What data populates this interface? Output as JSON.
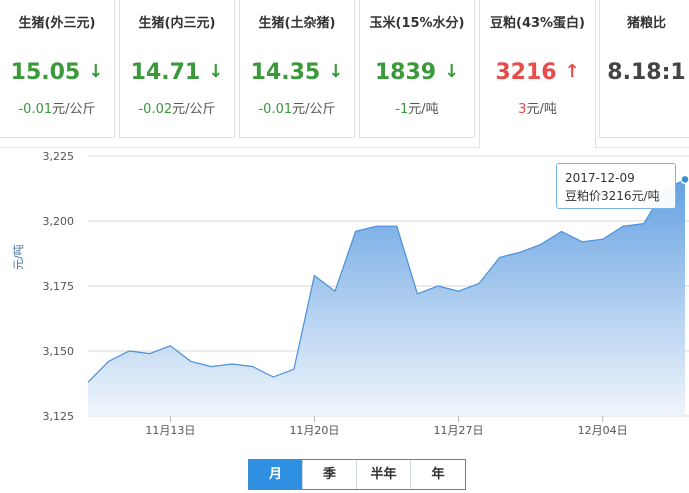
{
  "tabs": [
    {
      "title": "生猪(外三元)",
      "price": "15.05",
      "arrow": "↓",
      "trend": "down",
      "change": "-0.01",
      "unit": "元/公斤"
    },
    {
      "title": "生猪(内三元)",
      "price": "14.71",
      "arrow": "↓",
      "trend": "down",
      "change": "-0.02",
      "unit": "元/公斤"
    },
    {
      "title": "生猪(土杂猪)",
      "price": "14.35",
      "arrow": "↓",
      "trend": "down",
      "change": "-0.01",
      "unit": "元/公斤"
    },
    {
      "title": "玉米(15%水分)",
      "price": "1839",
      "arrow": "↓",
      "trend": "down",
      "change": "-1",
      "unit": "元/吨"
    },
    {
      "title": "豆粕(43%蛋白)",
      "price": "3216",
      "arrow": "↑",
      "trend": "up",
      "change": "3",
      "unit": "元/吨"
    },
    {
      "title": "猪粮比",
      "price": "8.18:1",
      "arrow": "",
      "trend": "neutral",
      "change": "",
      "unit": ""
    }
  ],
  "active_tab": 4,
  "tooltip": {
    "date": "2017-12-09",
    "text": "豆粕价3216元/吨"
  },
  "range_buttons": [
    {
      "label": "月",
      "active": true
    },
    {
      "label": "季",
      "active": false
    },
    {
      "label": "半年",
      "active": false
    },
    {
      "label": "年",
      "active": false
    }
  ],
  "colors": {
    "line": "#4a90d9",
    "area_top": "#5b9be0",
    "area_bottom": "#eef4fb",
    "grid": "#d8d8d8"
  },
  "chart_data": {
    "type": "area",
    "ylabel": "元/吨",
    "ylim": [
      3125,
      3225
    ],
    "yticks": [
      3125,
      3150,
      3175,
      3200,
      3225
    ],
    "ytick_labels": [
      "3,125",
      "3,150",
      "3,175",
      "3,200",
      "3,225"
    ],
    "xtick_labels": [
      "11月13日",
      "11月20日",
      "11月27日",
      "12月04日"
    ],
    "xtick_index": [
      4,
      11,
      18,
      25
    ],
    "series": [
      {
        "name": "豆粕价",
        "values": [
          3138,
          3146,
          3150,
          3149,
          3152,
          3146,
          3144,
          3145,
          3144,
          3140,
          3143,
          3179,
          3173,
          3196,
          3198,
          3198,
          3172,
          3175,
          3173,
          3176,
          3186,
          3188,
          3191,
          3196,
          3192,
          3193,
          3198,
          3199,
          3212,
          3216
        ]
      }
    ]
  }
}
